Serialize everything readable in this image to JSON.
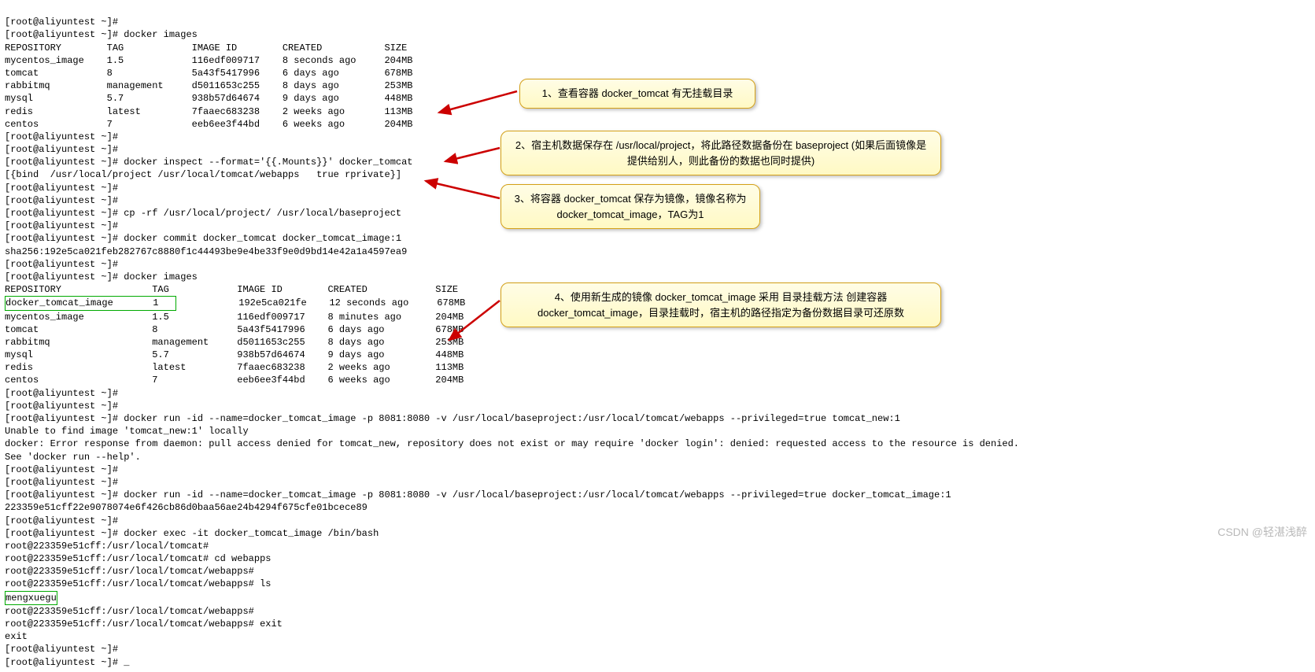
{
  "prompt1": "[root@aliyuntest ~]# ",
  "cmd": {
    "images": "docker images",
    "inspect": "docker inspect --format='{{.Mounts}}' docker_tomcat",
    "inspect_out": "[{bind  /usr/local/project /usr/local/tomcat/webapps   true rprivate}]",
    "cp": "cp -rf /usr/local/project/ /usr/local/baseproject",
    "commit": "docker commit docker_tomcat docker_tomcat_image:1",
    "sha": "sha256:192e5ca021feb282767c8880f1c44493be9e4be33f9e0d9bd14e42a1a4597ea9",
    "run1": "docker run -id --name=docker_tomcat_image -p 8081:8080 -v /usr/local/baseproject:/usr/local/tomcat/webapps --privileged=true tomcat_new:1",
    "err1": "Unable to find image 'tomcat_new:1' locally",
    "err2": "docker: Error response from daemon: pull access denied for tomcat_new, repository does not exist or may require 'docker login': denied: requested access to the resource is denied.",
    "err3": "See 'docker run --help'.",
    "run2": "docker run -id --name=docker_tomcat_image -p 8081:8080 -v /usr/local/baseproject:/usr/local/tomcat/webapps --privileged=true docker_tomcat_image:1",
    "cid": "223359e51cff22e9078074e6f426cb86d0baa56ae24b4294f675cfe01bcece89",
    "exec": "docker exec -it docker_tomcat_image /bin/bash"
  },
  "header1": "REPOSITORY        TAG            IMAGE ID        CREATED           SIZE",
  "images1": [
    "mycentos_image    1.5            116edf009717    8 seconds ago     204MB",
    "tomcat            8              5a43f5417996    6 days ago        678MB",
    "rabbitmq          management     d5011653c255    8 days ago        253MB",
    "mysql             5.7            938b57d64674    9 days ago        448MB",
    "redis             latest         7faaec683238    2 weeks ago       113MB",
    "centos            7              eeb6ee3f44bd    6 weeks ago       204MB"
  ],
  "header2": "REPOSITORY                TAG            IMAGE ID        CREATED            SIZE",
  "images2_first_repo": "docker_tomcat_image       1   ",
  "images2_first_rest": "           192e5ca021fe    12 seconds ago     678MB",
  "images2_rest": [
    "mycentos_image            1.5            116edf009717    8 minutes ago      204MB",
    "tomcat                    8              5a43f5417996    6 days ago         678MB",
    "rabbitmq                  management     d5011653c255    8 days ago         253MB",
    "mysql                     5.7            938b57d64674    9 days ago         448MB",
    "redis                     latest         7faaec683238    2 weeks ago        113MB",
    "centos                    7              eeb6ee3f44bd    6 weeks ago        204MB"
  ],
  "bash": {
    "p_tomcat": "root@223359e51cff:/usr/local/tomcat# ",
    "p_webapps": "root@223359e51cff:/usr/local/tomcat/webapps# ",
    "cd": "cd webapps",
    "ls": "ls",
    "ls_out": "mengxuegu",
    "exit": "exit",
    "exit_out": "exit"
  },
  "cursor": "_",
  "callouts": {
    "c1": "1、查看容器 docker_tomcat 有无挂载目录",
    "c2": "2、宿主机数据保存在 /usr/local/project，将此路径数据备份在 baseproject (如果后面镜像是提供给别人，则此备份的数据也同时提供)",
    "c3": "3、将容器 docker_tomcat 保存为镜像，镜像名称为 docker_tomcat_image，TAG为1",
    "c4": "4、使用新生成的镜像 docker_tomcat_image 采用 目录挂载方法 创建容器docker_tomcat_image，目录挂载时，宿主机的路径指定为备份数据目录可还原数"
  },
  "watermark": "CSDN @轻湛浅醉"
}
